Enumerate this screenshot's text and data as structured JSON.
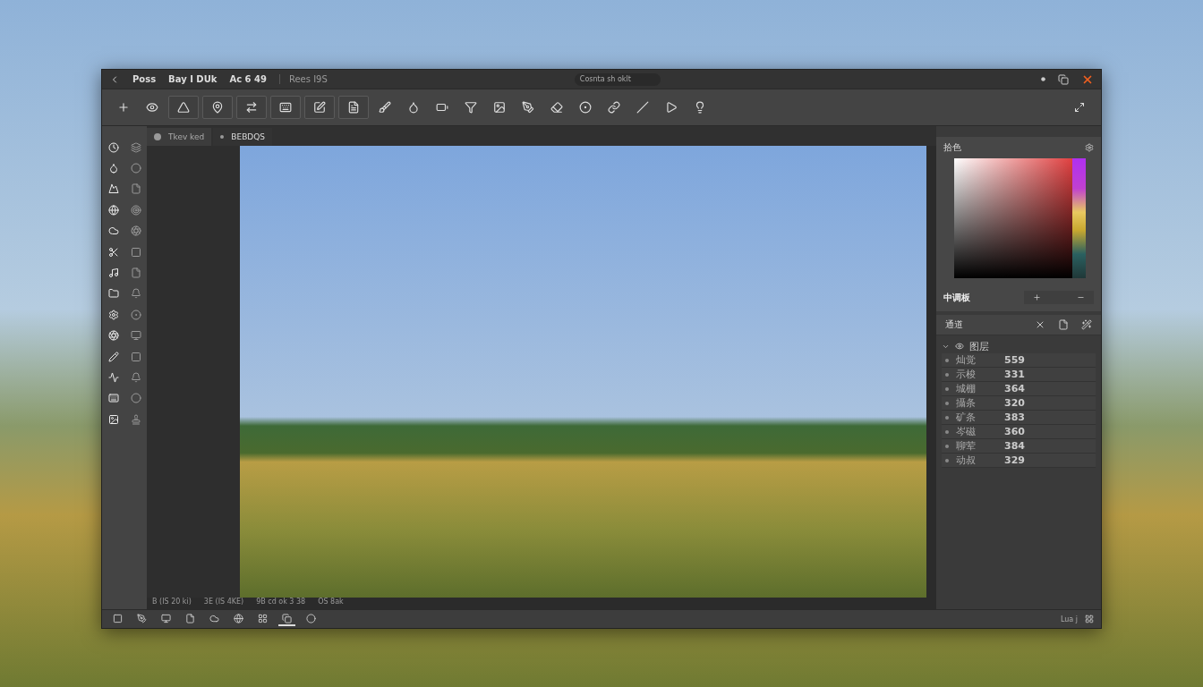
{
  "title_bar": {
    "menus": [
      "Poss",
      "Bay I DUk",
      "Ac 6 49"
    ],
    "document": "Rees I9S",
    "search": {
      "placeholder": "Cosnta sh oklt"
    }
  },
  "document_tabs": [
    {
      "label": "Tkev ked",
      "selected": true
    },
    {
      "label": "BEBDQS",
      "selected": false
    }
  ],
  "status_info": [
    "B (IS 20 ki)",
    "3E (IS 4KE)",
    "9B cd ok 3 38",
    "OS 8ak"
  ],
  "color_panel": {
    "title": "拾色",
    "swatch_label": "中调板"
  },
  "layers_panel": {
    "title": "通道",
    "group": {
      "name": "图层",
      "expanded": true
    },
    "rows": [
      {
        "name": "灿觉",
        "value": "559"
      },
      {
        "name": "示梭",
        "value": "331"
      },
      {
        "name": "城棚",
        "value": "364"
      },
      {
        "name": "攝条",
        "value": "320"
      },
      {
        "name": "矿条",
        "value": "383"
      },
      {
        "name": "岑磁",
        "value": "360"
      },
      {
        "name": "聊荤",
        "value": "384"
      },
      {
        "name": "动叔",
        "value": "329"
      }
    ]
  },
  "bottom_tools": [
    {
      "selected": false
    },
    {
      "selected": false
    },
    {
      "selected": false
    },
    {
      "selected": false
    },
    {
      "selected": false
    },
    {
      "selected": false
    },
    {
      "selected": false
    },
    {
      "selected": true
    },
    {
      "selected": false
    }
  ],
  "bottom_right": "Lua j"
}
